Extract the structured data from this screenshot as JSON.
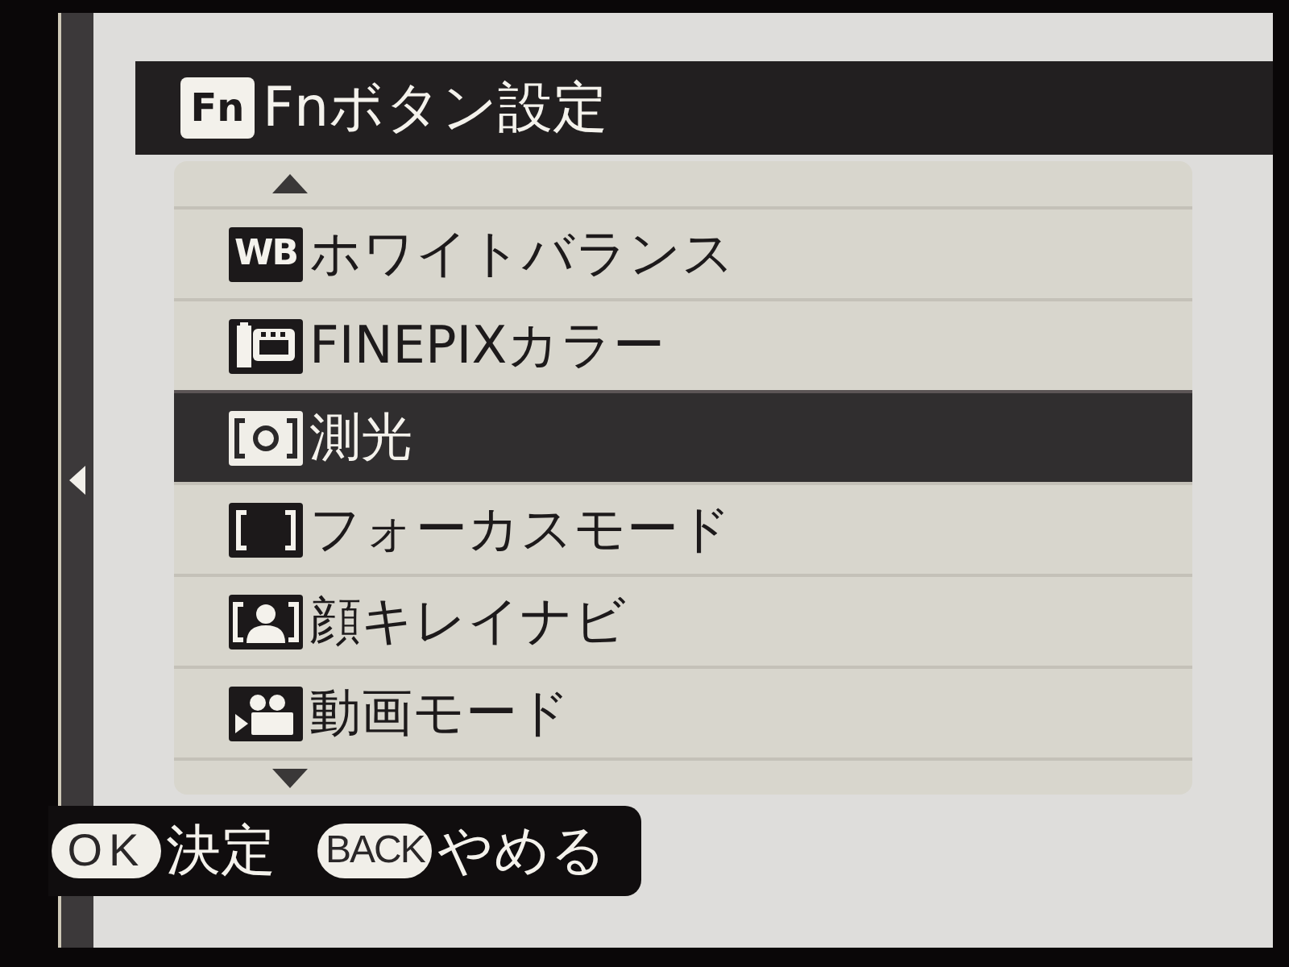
{
  "header": {
    "badge": "Fn",
    "title": "Fnボタン設定"
  },
  "menu": {
    "items": [
      {
        "kind": "wb",
        "badge": "WB",
        "label": "ホワイトバランス",
        "selected": false
      },
      {
        "kind": "film",
        "label": "FINEPIXカラー",
        "selected": false
      },
      {
        "kind": "metering",
        "label": "測光",
        "selected": true
      },
      {
        "kind": "focus",
        "label": "フォーカスモード",
        "selected": false
      },
      {
        "kind": "face",
        "label": "顔キレイナビ",
        "selected": false
      },
      {
        "kind": "movie",
        "label": "動画モード",
        "selected": false
      }
    ]
  },
  "footer": {
    "hints": [
      {
        "key": "OK",
        "label": "決定"
      },
      {
        "key": "BACK",
        "label": "やめる"
      }
    ]
  }
}
